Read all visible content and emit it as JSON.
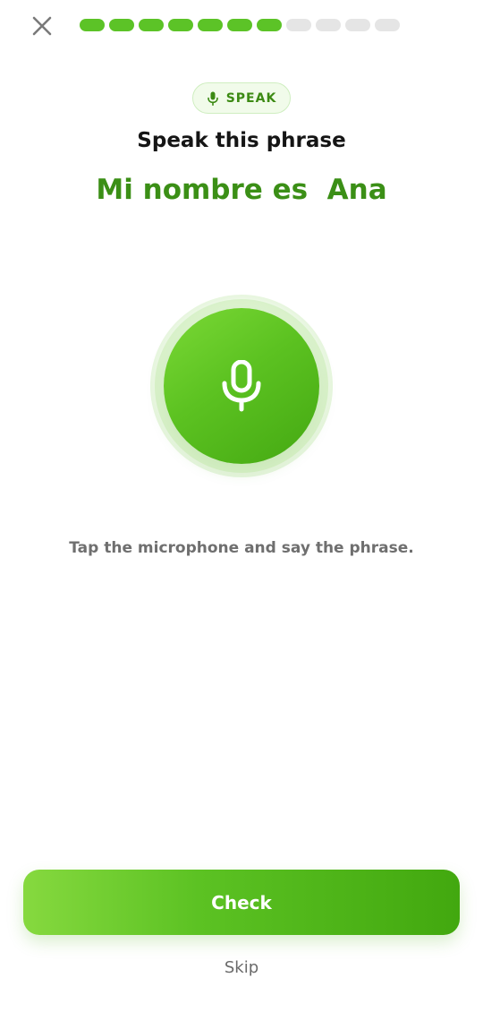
{
  "header": {
    "close_icon": "close-icon",
    "progress": {
      "completed": 7,
      "total": 11
    }
  },
  "badge": {
    "icon": "microphone-icon",
    "label": "SPEAK"
  },
  "prompt": {
    "instruction": "Speak this phrase",
    "phrase": "Mi nombre es  Ana"
  },
  "mic": {
    "icon": "microphone-icon"
  },
  "hint": "Tap the microphone and say the phrase.",
  "footer": {
    "check_label": "Check",
    "skip_label": "Skip"
  },
  "colors": {
    "accent": "#58cc02",
    "phrase": "#3b8f16",
    "progress_empty": "#e5e5e5"
  }
}
